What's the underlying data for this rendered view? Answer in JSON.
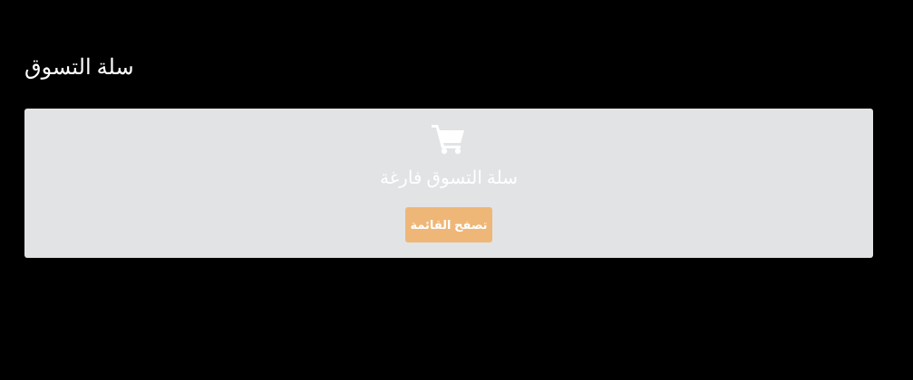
{
  "header": {
    "title": "سلة التسوق"
  },
  "cart": {
    "icon": "shopping-cart-icon",
    "empty_message": "سلة التسوق فارغة",
    "browse_label": "تصفح القائمة"
  },
  "colors": {
    "background": "#000000",
    "panel": "#e2e3e5",
    "button": "#eeb777",
    "text": "#ffffff"
  }
}
